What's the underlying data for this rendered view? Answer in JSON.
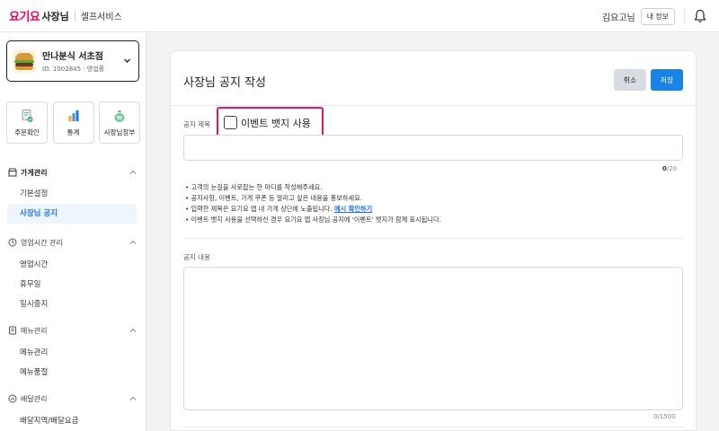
{
  "topbar": {
    "logo": "요기요",
    "owner_label": "사장님",
    "service_label": "셀프서비스",
    "user_name": "김요고님",
    "my_info_button": "내 정보"
  },
  "store": {
    "name": "만나분식 서초점",
    "id_line": "ID. 1002845 · 영업중"
  },
  "shortcuts": [
    {
      "label": "주문확인",
      "icon": "order-check-icon"
    },
    {
      "label": "통계",
      "icon": "stats-chart-icon"
    },
    {
      "label": "사장님장부",
      "icon": "money-bag-icon"
    }
  ],
  "nav": {
    "store_section": {
      "label": "가게관리",
      "items": [
        "기본설정",
        "사장님 공지"
      ]
    },
    "hours_section": {
      "label": "영업시간 관리",
      "items": [
        "영업시간",
        "휴무일",
        "일시중지"
      ]
    },
    "menu_section": {
      "label": "메뉴관리",
      "items": [
        "메뉴관리",
        "메뉴품절"
      ]
    },
    "delivery_section": {
      "label": "배달관리",
      "items": [
        "배달지역/배달요금"
      ]
    }
  },
  "form": {
    "page_title": "사장님 공지 작성",
    "cancel_label": "취소",
    "save_label": "저장",
    "title_label": "공지 제목",
    "event_badge_label": "이벤트 뱃지 사용",
    "title_value": "",
    "title_count": "0",
    "title_max": "/20",
    "notes": [
      "고객의 눈길을 사로잡는 한 마디를 작성해주세요.",
      "공지사항, 이벤트, 가게 쿠폰 등 알리고 싶은 내용을 홍보하세요.",
      "입력한 제목은 요기요 앱 내 가게 상단에 노출됩니다.",
      "이벤트 뱃지 사용을 선택하신 경우 요기요 앱 사장님 공지에 '이벤트' 뱃지가 함께 표시됩니다."
    ],
    "example_link": "예시 확인하기",
    "content_label": "공지 내용",
    "content_value": "",
    "content_count": "0",
    "content_max": "/1500"
  },
  "colors": {
    "brand": "#fa0050",
    "primary": "#1a84e6",
    "highlight": "#e8175d"
  }
}
